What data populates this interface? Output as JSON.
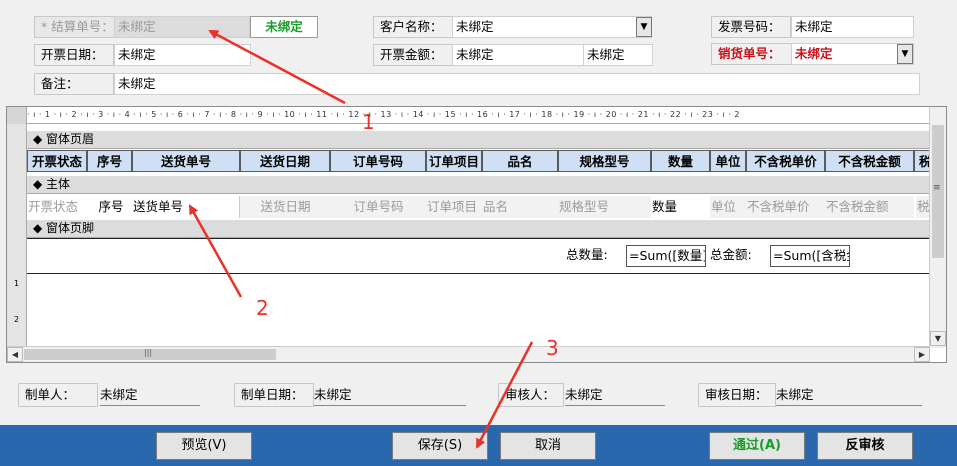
{
  "header": {
    "settle_no_label": "* 结算单号：",
    "settle_no_value": "未绑定",
    "settle_status_badge": "未绑定",
    "customer_label": "客户名称：",
    "customer_value": "未绑定",
    "invoice_no_label": "发票号码：",
    "invoice_no_value": "未绑定",
    "invoice_date_label": "开票日期：",
    "invoice_date_value": "未绑定",
    "invoice_amount_label": "开票金额：",
    "invoice_amount_value": "未绑定",
    "invoice_amount_value2": "未绑定",
    "sales_no_label": "销货单号：",
    "sales_no_value": "未绑定",
    "remark_label": "备注：",
    "remark_value": "未绑定"
  },
  "design": {
    "ruler_text": "· ı · 1 · ı · 2 · ı · 3 · ı · 4 · ı · 5 · ı · 6 · ı · 7 · ı · 8 · ı · 9 · ı · 10 · ı · 11 · ı · 12 · ı · 13 · ı · 14 · ı · 15 · ı · 16 · ı · 17 · ı · 18 · ı · 19 · ı · 20 · ı · 21 · ı · 22 · ı · 23 · ı · 2",
    "page_header_band": "窗体页眉",
    "detail_band": "主体",
    "page_footer_band": "窗体页脚",
    "columns": [
      "开票状态",
      "序号",
      "送货单号",
      "送货日期",
      "订单号码",
      "订单项目",
      "品名",
      "规格型号",
      "数量",
      "单位",
      "不含税单价",
      "不含税金额",
      "税"
    ],
    "detail_fields": [
      "开票状态",
      "序号",
      "送货单号",
      "送货日期",
      "订单号码",
      "订单项目",
      "品名",
      "规格型号",
      "数量",
      "单位",
      "不含税单价",
      "不含税金额",
      "税率"
    ],
    "footer": {
      "total_qty_label": "总数量:",
      "total_qty_expr": "=Sum([数量])",
      "total_amount_label": "总金额:",
      "total_amount_expr": "=Sum([含税金"
    },
    "left_ruler_marks": [
      "1",
      "2"
    ]
  },
  "audit": {
    "maker_label": "制单人：",
    "maker_value": "未绑定",
    "make_date_label": "制单日期：",
    "make_date_value": "未绑定",
    "reviewer_label": "审核人：",
    "reviewer_value": "未绑定",
    "review_date_label": "审核日期：",
    "review_date_value": "未绑定"
  },
  "buttons": {
    "preview": "预览(V)",
    "save": "保存(S)",
    "cancel": "取消",
    "approve": "通过(A)",
    "unapprove": "反审核"
  },
  "annotations": [
    "1",
    "2",
    "3"
  ],
  "colors": {
    "accent_green": "#1a9c2a",
    "accent_red": "#c8141e",
    "bottom_bar": "#2a68ae",
    "annotation_red": "#e8322a",
    "column_header": "#cfe0f4"
  }
}
